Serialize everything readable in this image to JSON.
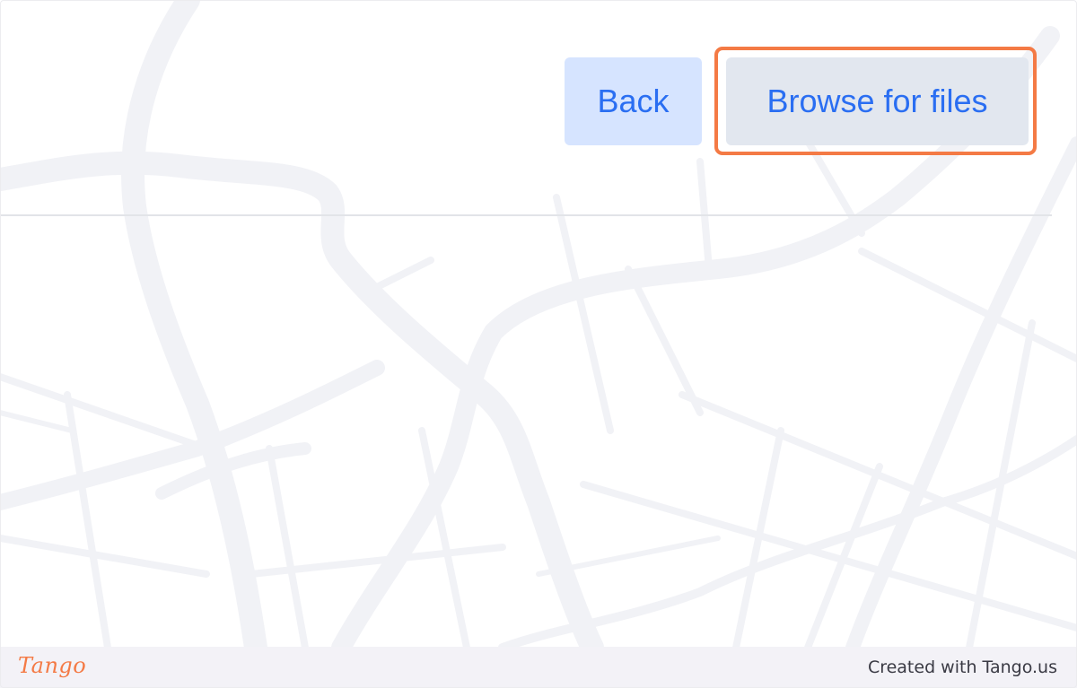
{
  "buttons": {
    "back_label": "Back",
    "browse_label": "Browse for files"
  },
  "footer": {
    "logo_text": "Tango",
    "created_with": "Created with Tango.us"
  },
  "colors": {
    "accent": "#f47a45",
    "button_text": "#2a6ef2",
    "back_bg": "#d6e4ff",
    "browse_bg": "#e2e7ef",
    "map_lines": "#f1f2f6"
  },
  "icons": {
    "background": "map-pattern"
  }
}
